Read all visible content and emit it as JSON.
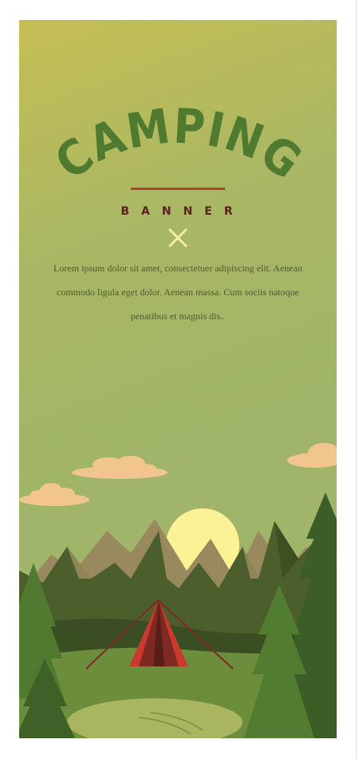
{
  "banner": {
    "title": "CAMPING",
    "subtitle": "BANNER",
    "body": "Lorem ipsum dolor sit amet, consectetuer adipiscing elit. Aenean commodo ligula eget dolor. Aenean massa. Cum sociis natoque penatibus et magnis dis..",
    "colors": {
      "title": "#4f7a30",
      "divider": "#b0432f",
      "subtitle": "#5a2220",
      "cross": "#f5f0a0",
      "sun": "#fbf296",
      "cloud": "#f2c58f",
      "tent": "#c83a2c"
    }
  },
  "icons": {
    "cross": "close-x-icon"
  }
}
